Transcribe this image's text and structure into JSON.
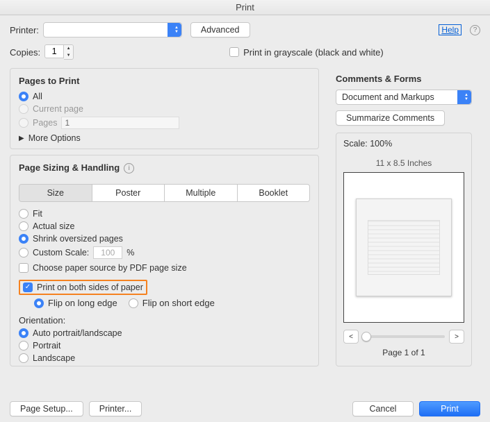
{
  "window": {
    "title": "Print"
  },
  "header": {
    "printer_label": "Printer:",
    "printer_value": "",
    "advanced": "Advanced",
    "help": "Help",
    "copies_label": "Copies:",
    "copies_value": "1",
    "grayscale": "Print in grayscale (black and white)"
  },
  "pages": {
    "title": "Pages to Print",
    "all": "All",
    "current": "Current page",
    "pages": "Pages",
    "pages_value": "1",
    "more": "More Options"
  },
  "sizing": {
    "title": "Page Sizing & Handling",
    "size": "Size",
    "poster": "Poster",
    "multiple": "Multiple",
    "booklet": "Booklet",
    "fit": "Fit",
    "actual": "Actual size",
    "shrink": "Shrink oversized pages",
    "custom": "Custom Scale:",
    "custom_value": "100",
    "pct": "%",
    "choose_source": "Choose paper source by PDF page size",
    "duplex": "Print on both sides of paper",
    "flip_long": "Flip on long edge",
    "flip_short": "Flip on short edge",
    "orientation_title": "Orientation:",
    "orient_auto": "Auto portrait/landscape",
    "orient_portrait": "Portrait",
    "orient_landscape": "Landscape"
  },
  "comments": {
    "title": "Comments & Forms",
    "select_value": "Document and Markups",
    "summarize": "Summarize Comments"
  },
  "preview": {
    "scale": "Scale: 100%",
    "dims": "11 x 8.5 Inches",
    "page_of": "Page 1 of 1"
  },
  "footer": {
    "page_setup": "Page Setup...",
    "printer": "Printer...",
    "cancel": "Cancel",
    "print": "Print"
  }
}
